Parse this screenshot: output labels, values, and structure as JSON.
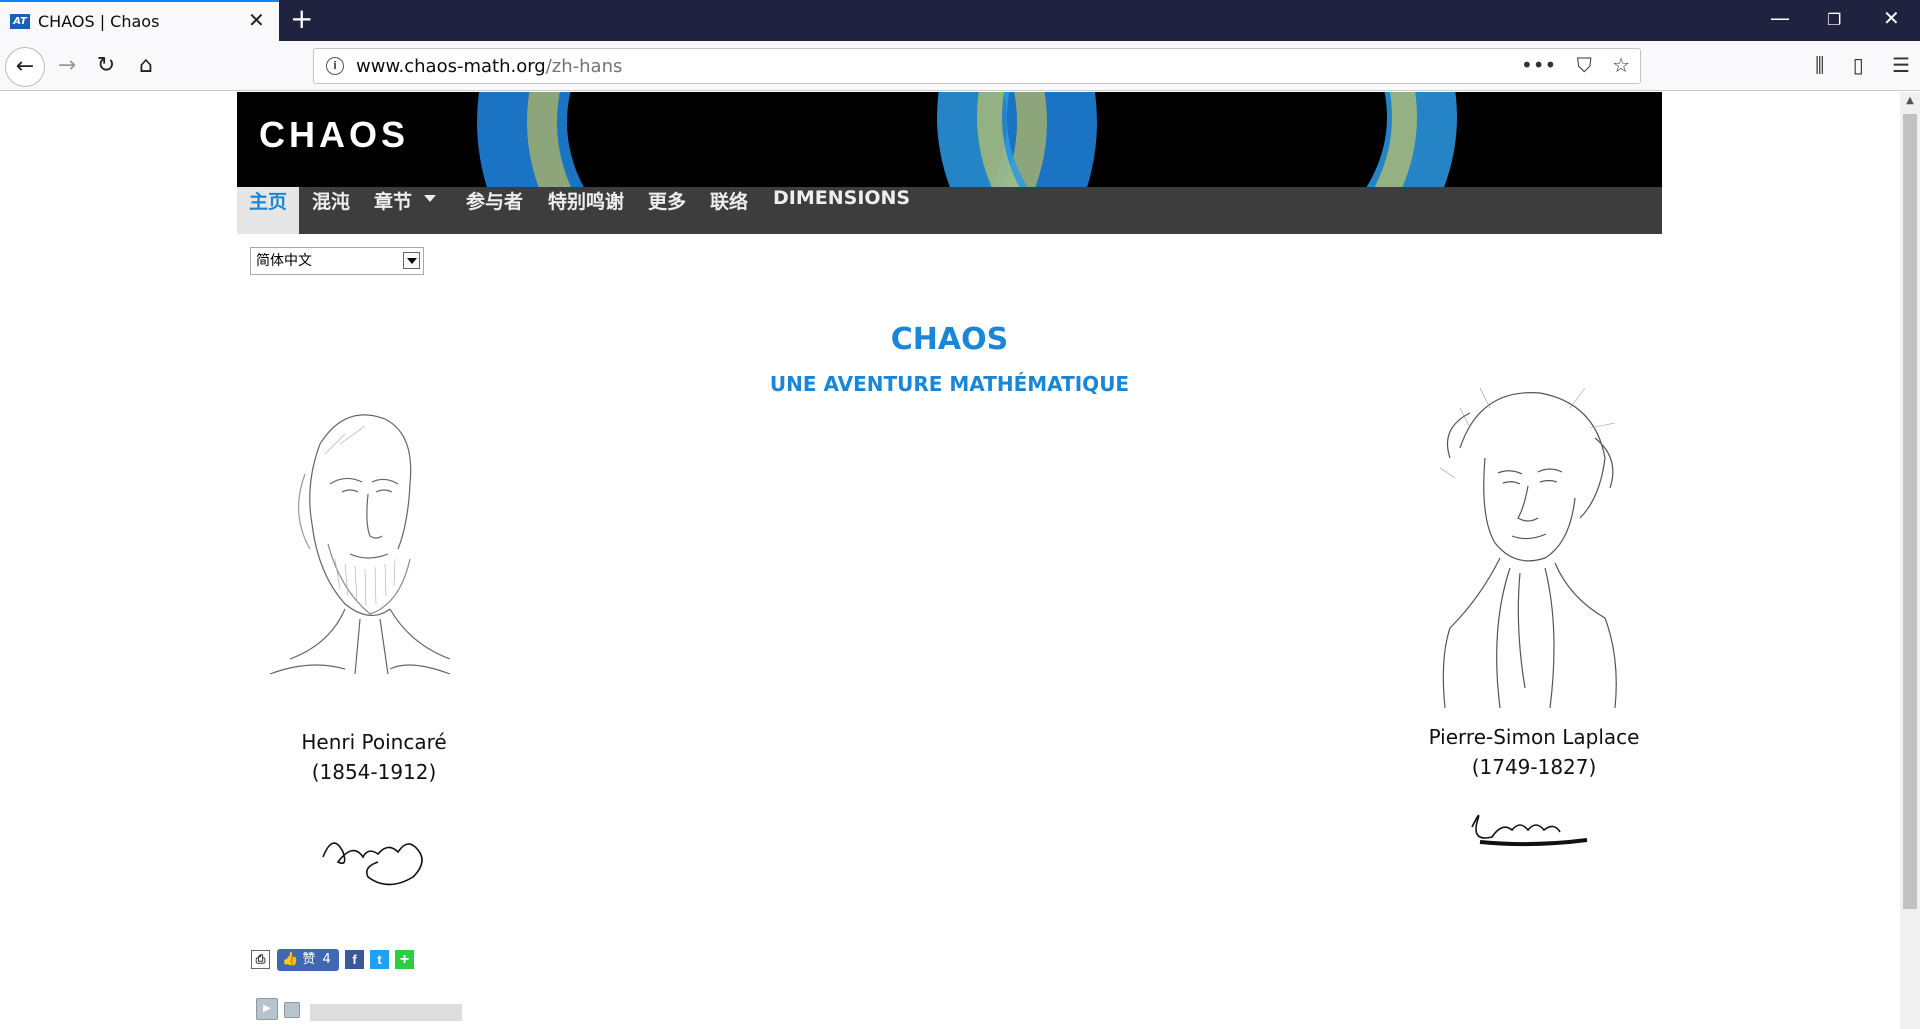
{
  "browser": {
    "tab_title": "CHAOS | Chaos",
    "tab_favicon": "AT",
    "url_host": "www.chaos-math.org",
    "url_path": "/zh-hans"
  },
  "banner": {
    "logo": "CHAOS"
  },
  "menu": {
    "items": [
      "主页",
      "混沌",
      "章节",
      "参与者",
      "特别鸣谢",
      "更多",
      "联络",
      "DIMENSIONS"
    ]
  },
  "language_select": {
    "value": "简体中文"
  },
  "main": {
    "title": "CHAOS",
    "subtitle": "UNE AVENTURE MATHÉMATIQUE"
  },
  "portraits": {
    "left": {
      "name": "Henri Poincaré",
      "years": "(1854-1912)"
    },
    "right": {
      "name": "Pierre-Simon Laplace",
      "years": "(1749-1827)"
    }
  },
  "social": {
    "like_label": "赞",
    "like_count": "4"
  },
  "icons": {
    "close": "close-icon",
    "plus": "plus-icon",
    "back": "back-arrow-icon",
    "forward": "forward-arrow-icon",
    "reload": "reload-icon",
    "home": "home-icon",
    "info": "info-icon",
    "more": "more-dots-icon",
    "pocket": "pocket-icon",
    "star": "star-icon",
    "library": "library-icon",
    "sidebar": "sidebar-icon",
    "menu": "hamburger-icon"
  },
  "colors": {
    "accent": "#1a86d8",
    "menu_bg": "#3d3d3d",
    "tabbar_bg": "#202340"
  }
}
